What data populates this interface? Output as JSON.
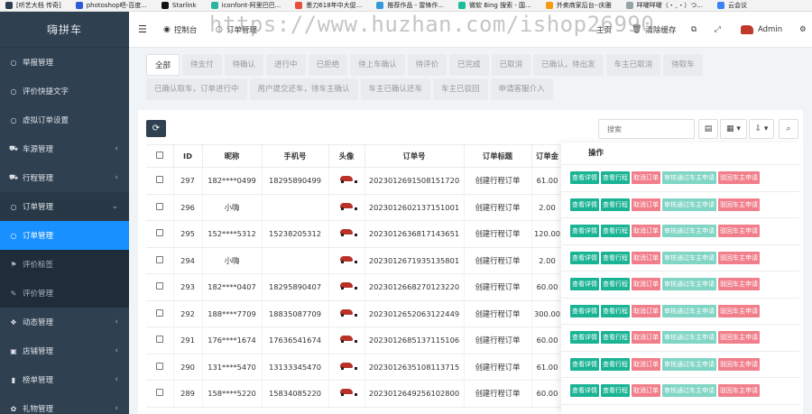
{
  "bookmarks": [
    {
      "label": "[听艺大档 传奇]",
      "color": "#2c3e50"
    },
    {
      "label": "photoshop吧-百度...",
      "color": "#2e5bd8"
    },
    {
      "label": "Starlink",
      "color": "#111111"
    },
    {
      "label": "iconfont-阿里巴巴...",
      "color": "#2bb3a3"
    },
    {
      "label": "墨刀618年中大促...",
      "color": "#e74c3c"
    },
    {
      "label": "推荐作品 - 雷锋作...",
      "color": "#3498db"
    },
    {
      "label": "微软 Bing 搜索 - 国...",
      "color": "#1abc9c"
    },
    {
      "label": "外卖商家后台--庆雅",
      "color": "#f39c12"
    },
    {
      "label": "咩嚯咩嚯（・ˍ・）つ...",
      "color": "#95a5a6"
    },
    {
      "label": "云会议",
      "color": "#3b82f6"
    }
  ],
  "brand": "嗨拼车",
  "topbar": {
    "menu_icon": "☰",
    "console": "控制台",
    "tab_order": "订单管理",
    "home": "主页",
    "clear_cache": "清除缓存",
    "admin": "Admin",
    "watermark": "https://www.huzhan.com/ishop26990"
  },
  "sidebar": {
    "items": [
      {
        "label": "举报管理",
        "icon": "○",
        "chev": ""
      },
      {
        "label": "评价快捷文字",
        "icon": "○",
        "chev": ""
      },
      {
        "label": "虚拟订单设置",
        "icon": "○",
        "chev": ""
      },
      {
        "label": "车源管理",
        "icon": "⛟",
        "chev": "‹"
      },
      {
        "label": "行程管理",
        "icon": "⛟",
        "chev": "‹"
      },
      {
        "label": "订单管理",
        "icon": "○",
        "chev": "⌄"
      },
      {
        "label": "订单管理",
        "icon": "○",
        "chev": ""
      },
      {
        "label": "评价标签",
        "icon": "⚑",
        "chev": ""
      },
      {
        "label": "评价管理",
        "icon": "✎",
        "chev": ""
      },
      {
        "label": "动态管理",
        "icon": "❖",
        "chev": "‹"
      },
      {
        "label": "店铺管理",
        "icon": "▣",
        "chev": "‹"
      },
      {
        "label": "榜单管理",
        "icon": "▮",
        "chev": "‹"
      },
      {
        "label": "礼物管理",
        "icon": "✿",
        "chev": "‹"
      }
    ]
  },
  "filters": {
    "row1": [
      "全部",
      "待支付",
      "待确认",
      "进行中",
      "已拒绝",
      "待上车确认",
      "待评价",
      "已完成",
      "已取消",
      "已确认，待出发",
      "车主已取消",
      "待取车"
    ],
    "row2": [
      "已确认取车，订单进行中",
      "用户提交还车，待车主确认",
      "车主已确认还车",
      "车主已驳回",
      "申请客服介入"
    ]
  },
  "toolbar": {
    "refresh_icon": "⟳",
    "search_placeholder": "搜索",
    "view_icon": "▤",
    "grid_icon": "▦ ▾",
    "export_icon": "⇩ ▾",
    "search_icon": "⌕"
  },
  "table": {
    "headers": [
      "ID",
      "昵称",
      "手机号",
      "头像",
      "订单号",
      "订单标题",
      "订单金"
    ],
    "rows": [
      {
        "id": "297",
        "nick": "182****0499",
        "phone": "18295890499",
        "order": "2023012691508151720",
        "title": "创建行程订单",
        "amount": "61.00"
      },
      {
        "id": "296",
        "nick": "小嗨",
        "phone": "",
        "order": "2023012602137151001",
        "title": "创建行程订单",
        "amount": "2.00"
      },
      {
        "id": "295",
        "nick": "152****5312",
        "phone": "15238205312",
        "order": "2023012636817143651",
        "title": "创建行程订单",
        "amount": "120.00"
      },
      {
        "id": "294",
        "nick": "小嗨",
        "phone": "",
        "order": "2023012671935135801",
        "title": "创建行程订单",
        "amount": "2.00"
      },
      {
        "id": "293",
        "nick": "182****0407",
        "phone": "18295890407",
        "order": "2023012668270123220",
        "title": "创建行程订单",
        "amount": "60.00"
      },
      {
        "id": "292",
        "nick": "188****7709",
        "phone": "18835087709",
        "order": "2023012652063122449",
        "title": "创建行程订单",
        "amount": "300.00"
      },
      {
        "id": "291",
        "nick": "176****1674",
        "phone": "17636541674",
        "order": "2023012685137115106",
        "title": "创建行程订单",
        "amount": "60.00"
      },
      {
        "id": "290",
        "nick": "131****5470",
        "phone": "13133345470",
        "order": "2023012635108113715",
        "title": "创建行程订单",
        "amount": "61.00"
      },
      {
        "id": "289",
        "nick": "158****5220",
        "phone": "15834085220",
        "order": "2023012649256102800",
        "title": "创建行程订单",
        "amount": "60.00"
      }
    ]
  },
  "ops": {
    "header": "操作",
    "buttons": [
      "查看详情",
      "查看行程",
      "取消订单",
      "审核通过车主申请",
      "驳回车主申请"
    ]
  },
  "colors": {
    "sidebar": "#2f4050",
    "active": "#1890ff",
    "green": "#1ab394",
    "red": "#ed5565"
  }
}
